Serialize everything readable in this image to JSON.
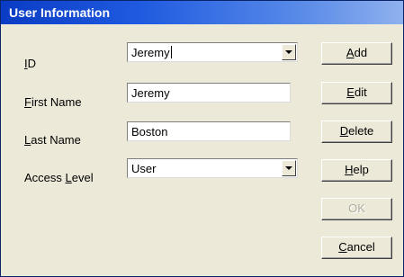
{
  "window": {
    "title": "User Information"
  },
  "form": {
    "id_label": "ID",
    "id_label_key": "I",
    "id_label_rest": "D",
    "id_value": "Jeremy",
    "first_name_label_key": "F",
    "first_name_label_rest": "irst Name",
    "first_name_value": "Jeremy",
    "last_name_label_key": "L",
    "last_name_label_rest": "ast Name",
    "last_name_value": "Boston",
    "access_level_label_pre": "Access ",
    "access_level_label_key": "L",
    "access_level_label_rest": "evel",
    "access_level_value": "User"
  },
  "buttons": {
    "add_key": "A",
    "add_rest": "dd",
    "edit_key": "E",
    "edit_rest": "dit",
    "delete_key": "D",
    "delete_rest": "elete",
    "help_key": "H",
    "help_rest": "elp",
    "ok_label": "OK",
    "cancel_key": "C",
    "cancel_rest": "ancel"
  },
  "colors": {
    "titlebar_start": "#0a3cc4",
    "titlebar_end": "#8fb1ee",
    "dialog_face": "#ece9d8"
  },
  "icons": {
    "dropdown": "chevron-down-icon"
  }
}
